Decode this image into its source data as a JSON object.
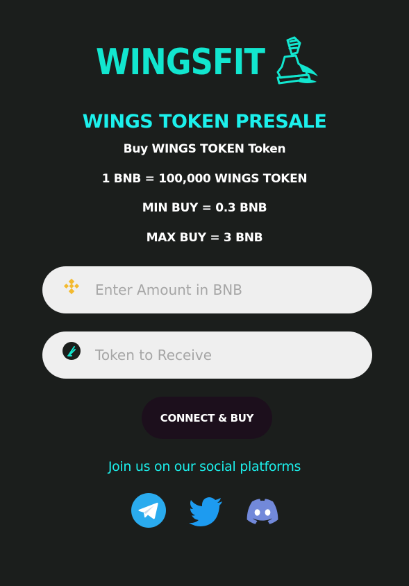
{
  "brand": {
    "logo_text": "WINGSFIT",
    "accent_color": "#12e6cf"
  },
  "presale": {
    "title": "WINGS TOKEN PRESALE",
    "subtitle": "Buy WINGS TOKEN Token",
    "rate": "1 BNB = 100,000 WINGS TOKEN",
    "min_buy": "MIN BUY = 0.3 BNB",
    "max_buy": "MAX BUY = 3 BNB"
  },
  "form": {
    "amount_field": {
      "icon": "bnb-icon",
      "placeholder": "Enter Amount in BNB",
      "value": ""
    },
    "receive_field": {
      "icon": "wings-token-icon",
      "placeholder": "Token to Receive",
      "value": ""
    },
    "buy_button_label": "CONNECT & BUY"
  },
  "social": {
    "heading": "Join us on our social platforms",
    "links": [
      {
        "icon": "telegram-icon",
        "color": "#2aabee"
      },
      {
        "icon": "twitter-icon",
        "color": "#1d9bf0"
      },
      {
        "icon": "discord-icon",
        "color": "#7289da"
      }
    ]
  }
}
